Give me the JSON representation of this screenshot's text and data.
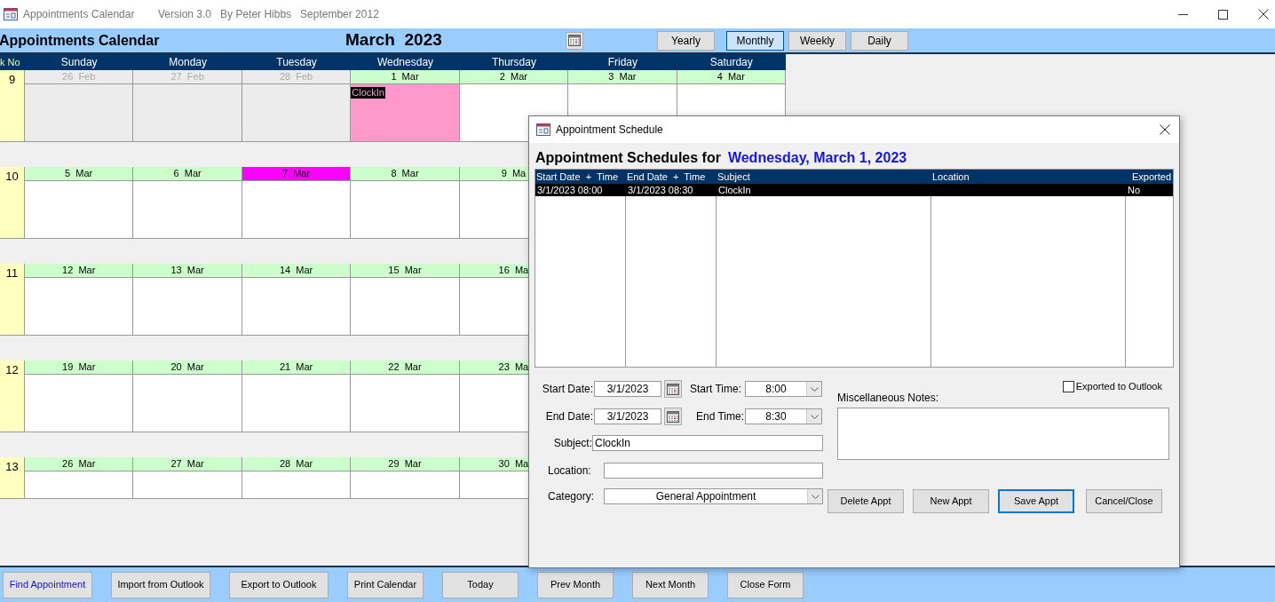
{
  "window": {
    "title": "Appointments Calendar",
    "subtitle": "Version 3.0   By Peter Hibbs   September 2012"
  },
  "header": {
    "title": "Appointments Calendar",
    "month": "March  2023",
    "views": [
      {
        "label": "Yearly",
        "selected": false
      },
      {
        "label": "Monthly",
        "selected": true
      },
      {
        "label": "Weekly",
        "selected": false
      },
      {
        "label": "Daily",
        "selected": false
      }
    ]
  },
  "calendar": {
    "week_heading": "k No",
    "day_names": [
      "Sunday",
      "Monday",
      "Tuesday",
      "Wednesday",
      "Thursday",
      "Friday",
      "Saturday"
    ],
    "weeks": [
      {
        "number": "9",
        "days": [
          {
            "label": "26  Feb",
            "kind": "other"
          },
          {
            "label": "27  Feb",
            "kind": "other"
          },
          {
            "label": "28  Feb",
            "kind": "other"
          },
          {
            "label": "1  Mar",
            "kind": "current",
            "appointments": [
              {
                "subject": "ClockIn"
              }
            ]
          },
          {
            "label": "2  Mar",
            "kind": "current"
          },
          {
            "label": "3  Mar",
            "kind": "current"
          },
          {
            "label": "4  Mar",
            "kind": "current"
          }
        ]
      },
      {
        "number": "10",
        "days": [
          {
            "label": "5  Mar",
            "kind": "current"
          },
          {
            "label": "6  Mar",
            "kind": "current"
          },
          {
            "label": "7  Mar",
            "kind": "today"
          },
          {
            "label": "8  Mar",
            "kind": "current"
          },
          {
            "label": "9  Ma",
            "kind": "current"
          }
        ]
      },
      {
        "number": "11",
        "days": [
          {
            "label": "12  Mar",
            "kind": "current"
          },
          {
            "label": "13  Mar",
            "kind": "current"
          },
          {
            "label": "14  Mar",
            "kind": "current"
          },
          {
            "label": "15  Mar",
            "kind": "current"
          },
          {
            "label": "16  Ma",
            "kind": "current"
          }
        ]
      },
      {
        "number": "12",
        "days": [
          {
            "label": "19  Mar",
            "kind": "current"
          },
          {
            "label": "20  Mar",
            "kind": "current"
          },
          {
            "label": "21  Mar",
            "kind": "current"
          },
          {
            "label": "22  Mar",
            "kind": "current"
          },
          {
            "label": "23  Ma",
            "kind": "current"
          }
        ]
      },
      {
        "number": "13",
        "days": [
          {
            "label": "26  Mar",
            "kind": "current"
          },
          {
            "label": "27  Mar",
            "kind": "current"
          },
          {
            "label": "28  Mar",
            "kind": "current"
          },
          {
            "label": "29  Mar",
            "kind": "current"
          },
          {
            "label": "30  Ma",
            "kind": "current"
          }
        ]
      }
    ]
  },
  "toolbar": [
    {
      "label": "Find Appointment",
      "kind": "link"
    },
    {
      "label": "Import from Outlook",
      "kind": "normal"
    },
    {
      "label": "Export to Outlook",
      "kind": "normal"
    },
    {
      "label": "Print Calendar",
      "kind": "normal"
    },
    {
      "label": "Today",
      "kind": "normal"
    },
    {
      "label": "Prev Month",
      "kind": "normal"
    },
    {
      "label": "Next Month",
      "kind": "normal"
    },
    {
      "label": "Close Form",
      "kind": "normal"
    }
  ],
  "dialog": {
    "title": "Appointment Schedule",
    "heading": "Appointment Schedules for",
    "date": "Wednesday, March 1, 2023",
    "table": {
      "columns": [
        "Start Date  +  Time",
        "End Date  +  Time",
        "Subject",
        "Location",
        "Exported"
      ],
      "rows": [
        {
          "start": "3/1/2023 08:00",
          "end": "3/1/2023 08:30",
          "subject": "ClockIn",
          "exported": "No",
          "selected": true
        }
      ]
    },
    "start_date": {
      "label": "Start Date:",
      "value": "3/1/2023"
    },
    "start_time": {
      "label": "Start Time:",
      "value": "8:00"
    },
    "end_date": {
      "label": "End Date:",
      "value": "3/1/2023"
    },
    "end_time": {
      "label": "End Time:",
      "value": "8:30"
    },
    "subject": {
      "label": "Subject:",
      "value": "ClockIn"
    },
    "location": {
      "label": "Location:"
    },
    "category": {
      "label": "Category:",
      "value": "General Appointment"
    },
    "exported": {
      "label": "Exported to Outlook",
      "checked": false
    },
    "notes": {
      "label": "Miscellaneous Notes:"
    },
    "buttons": [
      {
        "label": "Delete Appt",
        "focused": false
      },
      {
        "label": "New Appt",
        "focused": false
      },
      {
        "label": "Save Appt",
        "focused": true
      },
      {
        "label": "Cancel/Close",
        "focused": false
      }
    ]
  }
}
